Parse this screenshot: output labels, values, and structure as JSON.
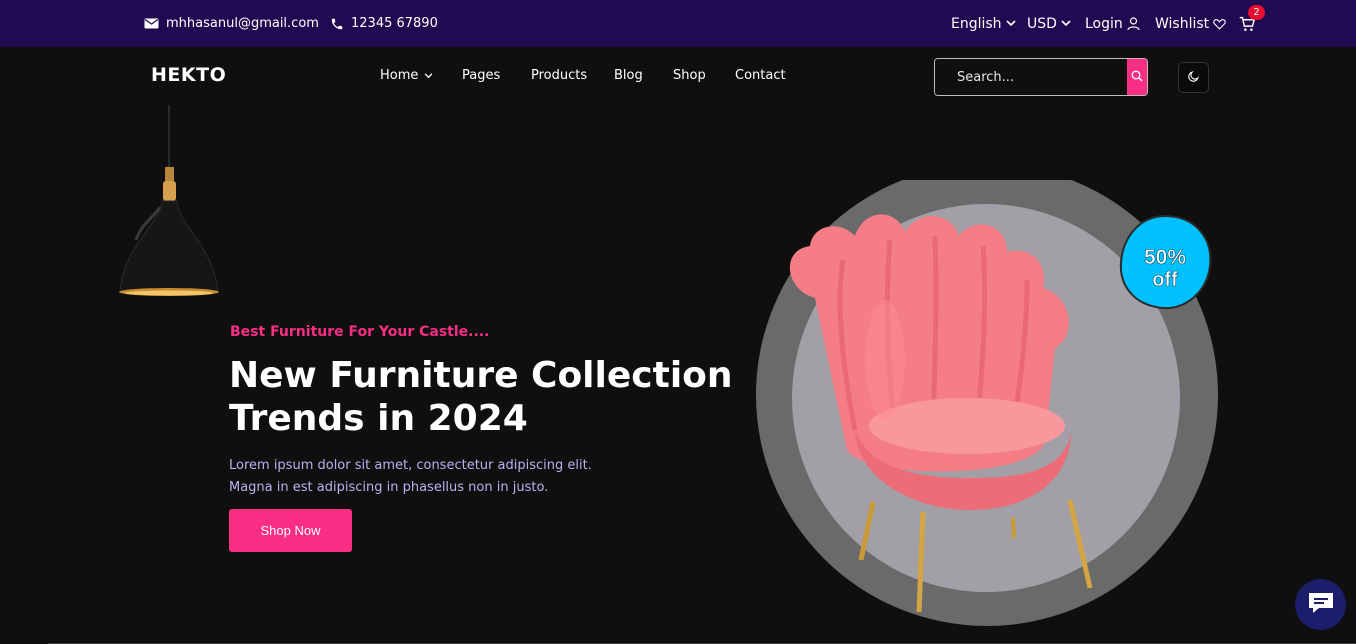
{
  "topbar": {
    "email": "mhhasanul@gmail.com",
    "phone": "12345 67890",
    "language": "English",
    "currency": "USD",
    "login": "Login",
    "wishlist": "Wishlist",
    "cart_count": "2",
    "icons": [
      "mail-icon",
      "phone-icon",
      "chevron-down-icon",
      "user-icon",
      "heart-icon",
      "cart-icon"
    ]
  },
  "nav": {
    "logo": "HEKTO",
    "items": [
      "Home",
      "Pages",
      "Products",
      "Blog",
      "Shop",
      "Contact"
    ],
    "search_placeholder": "Search...",
    "icons": [
      "search-icon",
      "moon-icon"
    ]
  },
  "hero": {
    "tagline": "Best Furniture For Your Castle....",
    "headline": "New Furniture Collection Trends in 2024",
    "description": "Lorem ipsum dolor sit amet, consectetur adipiscing elit. Magna in est adipiscing in phasellus non in justo.",
    "cta": "Shop Now",
    "badge_percent": "50%",
    "badge_off": "off"
  },
  "colors": {
    "topbar": "#210a52",
    "background": "#0f0f0f",
    "accent_pink": "#fb2e86",
    "badge_cyan": "#00c1fe",
    "chat": "#1c1e6b"
  }
}
